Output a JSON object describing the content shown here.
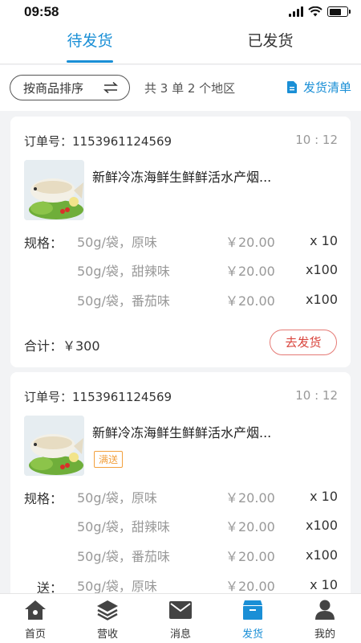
{
  "status": {
    "time": "09:58"
  },
  "tabs": [
    {
      "label": "待发货",
      "active": true
    },
    {
      "label": "已发货",
      "active": false
    }
  ],
  "filter": {
    "sort_label": "按商品排序",
    "summary": "共 3 单  2 个地区",
    "ship_list_label": "发货清单"
  },
  "orders": [
    {
      "order_label": "订单号：",
      "order_no": "1153961124569",
      "time": "10 : 12",
      "product_name": "新鲜冷冻海鲜生鲜鲜活水产烟...",
      "spec_label": "规格：",
      "items": [
        {
          "spec": "50g/袋，原味",
          "price": "￥20.00",
          "qty": "x  10"
        },
        {
          "spec": "50g/袋，甜辣味",
          "price": "￥20.00",
          "qty": "x100"
        },
        {
          "spec": "50g/袋，番茄味",
          "price": "￥20.00",
          "qty": "x100"
        }
      ],
      "total": "合计：￥300",
      "ship_button": "去发货"
    },
    {
      "order_label": "订单号：",
      "order_no": "1153961124569",
      "time": "10 : 12",
      "product_name": "新鲜冷冻海鲜生鲜鲜活水产烟...",
      "tag": "满送",
      "spec_label": "规格：",
      "items": [
        {
          "spec": "50g/袋，原味",
          "price": "￥20.00",
          "qty": "x  10"
        },
        {
          "spec": "50g/袋，甜辣味",
          "price": "￥20.00",
          "qty": "x100"
        },
        {
          "spec": "50g/袋，番茄味",
          "price": "￥20.00",
          "qty": "x100"
        }
      ],
      "gift_label": "送：",
      "gift_item": {
        "spec": "50g/袋，原味",
        "price": "￥20.00",
        "qty": "x  10"
      }
    }
  ],
  "nav": [
    {
      "label": "首页",
      "icon": "home-icon",
      "active": false
    },
    {
      "label": "营收",
      "icon": "layers-icon",
      "active": false
    },
    {
      "label": "消息",
      "icon": "mail-icon",
      "active": false
    },
    {
      "label": "发货",
      "icon": "box-icon",
      "active": true
    },
    {
      "label": "我的",
      "icon": "user-icon",
      "active": false
    }
  ],
  "colors": {
    "accent": "#1a8fd6",
    "button_red": "#d9443c",
    "tag_orange": "#f2a03d"
  }
}
